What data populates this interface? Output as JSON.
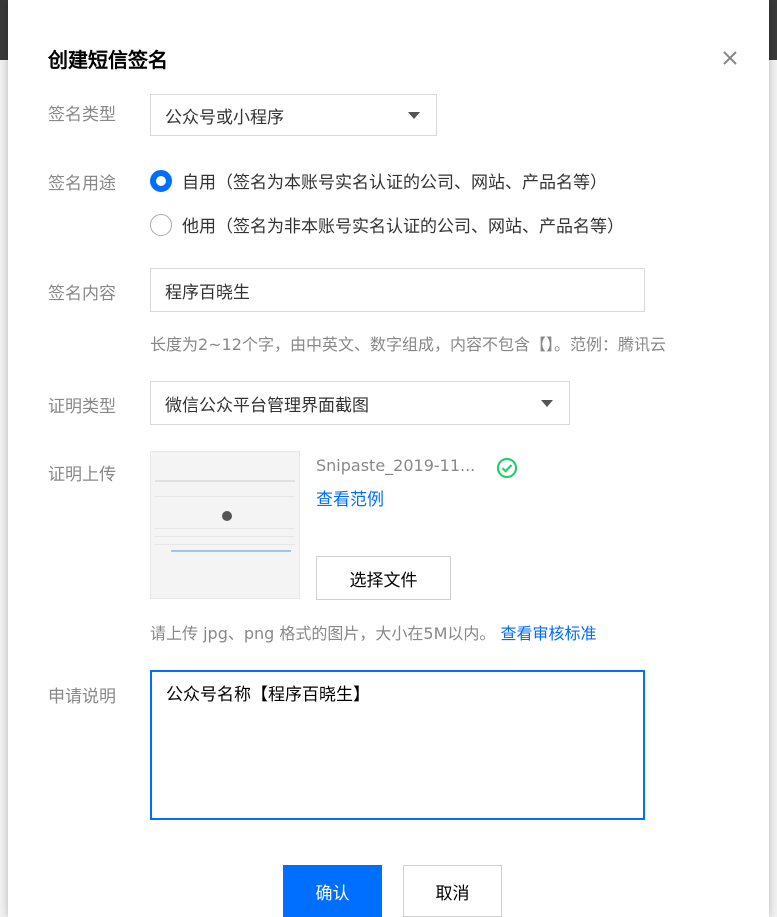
{
  "dialog": {
    "title": "创建短信签名",
    "close_icon": "close-icon"
  },
  "form": {
    "sign_type": {
      "label": "签名类型",
      "value": "公众号或小程序"
    },
    "sign_use": {
      "label": "签名用途",
      "options": [
        {
          "label": "自用（签名为本账号实名认证的公司、网站、产品名等）",
          "selected": true
        },
        {
          "label": "他用（签名为非本账号实名认证的公司、网站、产品名等）",
          "selected": false
        }
      ]
    },
    "sign_content": {
      "label": "签名内容",
      "value": "程序百晓生",
      "hint": "长度为2~12个字，由中英文、数字组成，内容不包含【】。范例：腾讯云"
    },
    "cert_type": {
      "label": "证明类型",
      "value": "微信公众平台管理界面截图"
    },
    "cert_upload": {
      "label": "证明上传",
      "file_name": "Snipaste_2019-11...",
      "example_link": "查看范例",
      "choose_button": "选择文件",
      "hint": "请上传 jpg、png 格式的图片，大小在5M以内。",
      "standard_link": "查看审核标准"
    },
    "apply_note": {
      "label": "申请说明",
      "value": "公众号名称【程序百晓生】"
    }
  },
  "footer": {
    "confirm": "确认",
    "cancel": "取消"
  },
  "colors": {
    "accent": "#006eff",
    "success": "#29cc6a"
  }
}
